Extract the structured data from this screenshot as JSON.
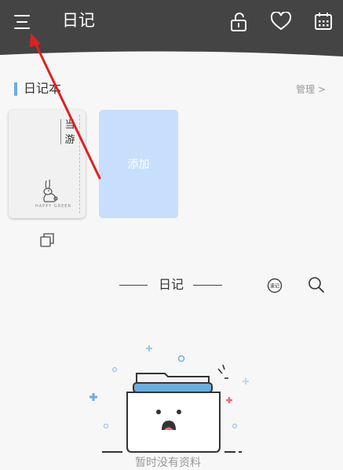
{
  "header": {
    "title": "日记",
    "menu_icon": "menu-icon",
    "lock_icon": "unlock-icon",
    "favorite_icon": "heart-icon",
    "calendar_icon": "calendar-icon",
    "background_color": "#444444"
  },
  "notebooks": {
    "section_title": "日记本",
    "manage_label": "管理 >",
    "accent_color": "#69aee8",
    "items": [
      {
        "title": "当游",
        "subtitle": "HAPPY GREEN"
      }
    ],
    "add_label": "添加",
    "add_color": "#c7dffd"
  },
  "diary": {
    "heading": "日记",
    "bubble_label": "速记",
    "search_icon": "search-icon"
  },
  "empty_state": {
    "text": "暂时没有资料",
    "illustration": "empty-folder-illustration"
  },
  "annotation": {
    "arrow_color": "#e02020"
  }
}
